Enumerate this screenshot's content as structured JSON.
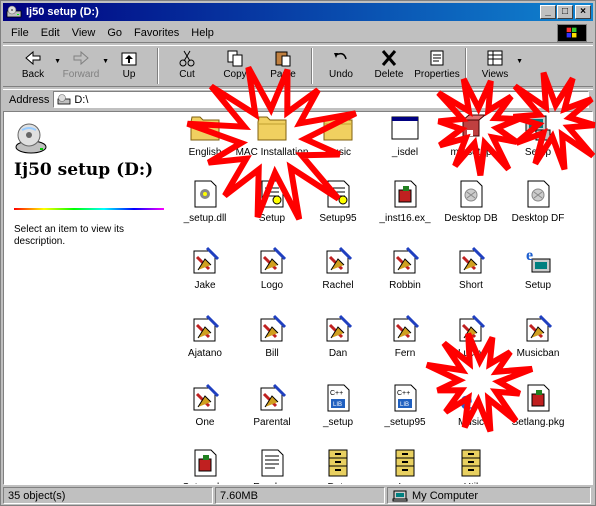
{
  "window": {
    "title": "Ij50 setup (D:)",
    "min": "_",
    "max": "□",
    "close": "×"
  },
  "menu": [
    "File",
    "Edit",
    "View",
    "Go",
    "Favorites",
    "Help"
  ],
  "toolbar": [
    {
      "label": "Back",
      "icon": "back-arrow-icon"
    },
    {
      "label": "Forward",
      "icon": "forward-arrow-icon"
    },
    {
      "label": "Up",
      "icon": "up-folder-icon"
    },
    {
      "label": "Cut",
      "icon": "scissors-icon"
    },
    {
      "label": "Copy",
      "icon": "copy-icon"
    },
    {
      "label": "Paste",
      "icon": "paste-icon"
    },
    {
      "label": "Undo",
      "icon": "undo-icon"
    },
    {
      "label": "Delete",
      "icon": "delete-x-icon"
    },
    {
      "label": "Properties",
      "icon": "properties-icon"
    },
    {
      "label": "Views",
      "icon": "views-icon"
    }
  ],
  "address": {
    "label": "Address",
    "value": "D:\\"
  },
  "leftpane": {
    "title": "Ij50 setup (D:)",
    "description": "Select an item to view its description."
  },
  "files": [
    {
      "name": "English",
      "type": "folder"
    },
    {
      "name": "MAC Installation",
      "type": "folder"
    },
    {
      "name": "Music",
      "type": "folder"
    },
    {
      "name": "_isdel",
      "type": "app"
    },
    {
      "name": "mmsetup",
      "type": "setup"
    },
    {
      "name": "Setup",
      "type": "setup-pc"
    },
    {
      "name": "_setup.dll",
      "type": "dll"
    },
    {
      "name": "Setup",
      "type": "ini"
    },
    {
      "name": "Setup95",
      "type": "ini"
    },
    {
      "name": "_inst16.ex_",
      "type": "package"
    },
    {
      "name": "Desktop DB",
      "type": "doc-gray"
    },
    {
      "name": "Desktop DF",
      "type": "doc-gray"
    },
    {
      "name": "Jake",
      "type": "paint"
    },
    {
      "name": "Logo",
      "type": "paint"
    },
    {
      "name": "Rachel",
      "type": "paint"
    },
    {
      "name": "Robbin",
      "type": "paint"
    },
    {
      "name": "Short",
      "type": "paint"
    },
    {
      "name": "Setup",
      "type": "ie-setup"
    },
    {
      "name": "Ajatano",
      "type": "paint"
    },
    {
      "name": "Bill",
      "type": "paint"
    },
    {
      "name": "Dan",
      "type": "paint"
    },
    {
      "name": "Fern",
      "type": "paint"
    },
    {
      "name": "Lucky",
      "type": "paint"
    },
    {
      "name": "Musicban",
      "type": "paint"
    },
    {
      "name": "One",
      "type": "paint"
    },
    {
      "name": "Parental",
      "type": "paint"
    },
    {
      "name": "_setup",
      "type": "lib"
    },
    {
      "name": "_setup95",
      "type": "lib"
    },
    {
      "name": "Music",
      "type": "ie"
    },
    {
      "name": "Setlang.pkg",
      "type": "package"
    },
    {
      "name": "Setup.pkg",
      "type": "package"
    },
    {
      "name": "Readme",
      "type": "text"
    },
    {
      "name": "Data",
      "type": "cabinet"
    },
    {
      "name": "Ins",
      "type": "cabinet"
    },
    {
      "name": "Util",
      "type": "cabinet"
    }
  ],
  "status": {
    "objects": "35 object(s)",
    "size": "7.60MB",
    "zone": "My Computer"
  },
  "colors": {
    "title_start": "#000080",
    "title_end": "#1084d0",
    "burst_fill": "#ff0000",
    "burst_stroke": "#ffffff"
  }
}
